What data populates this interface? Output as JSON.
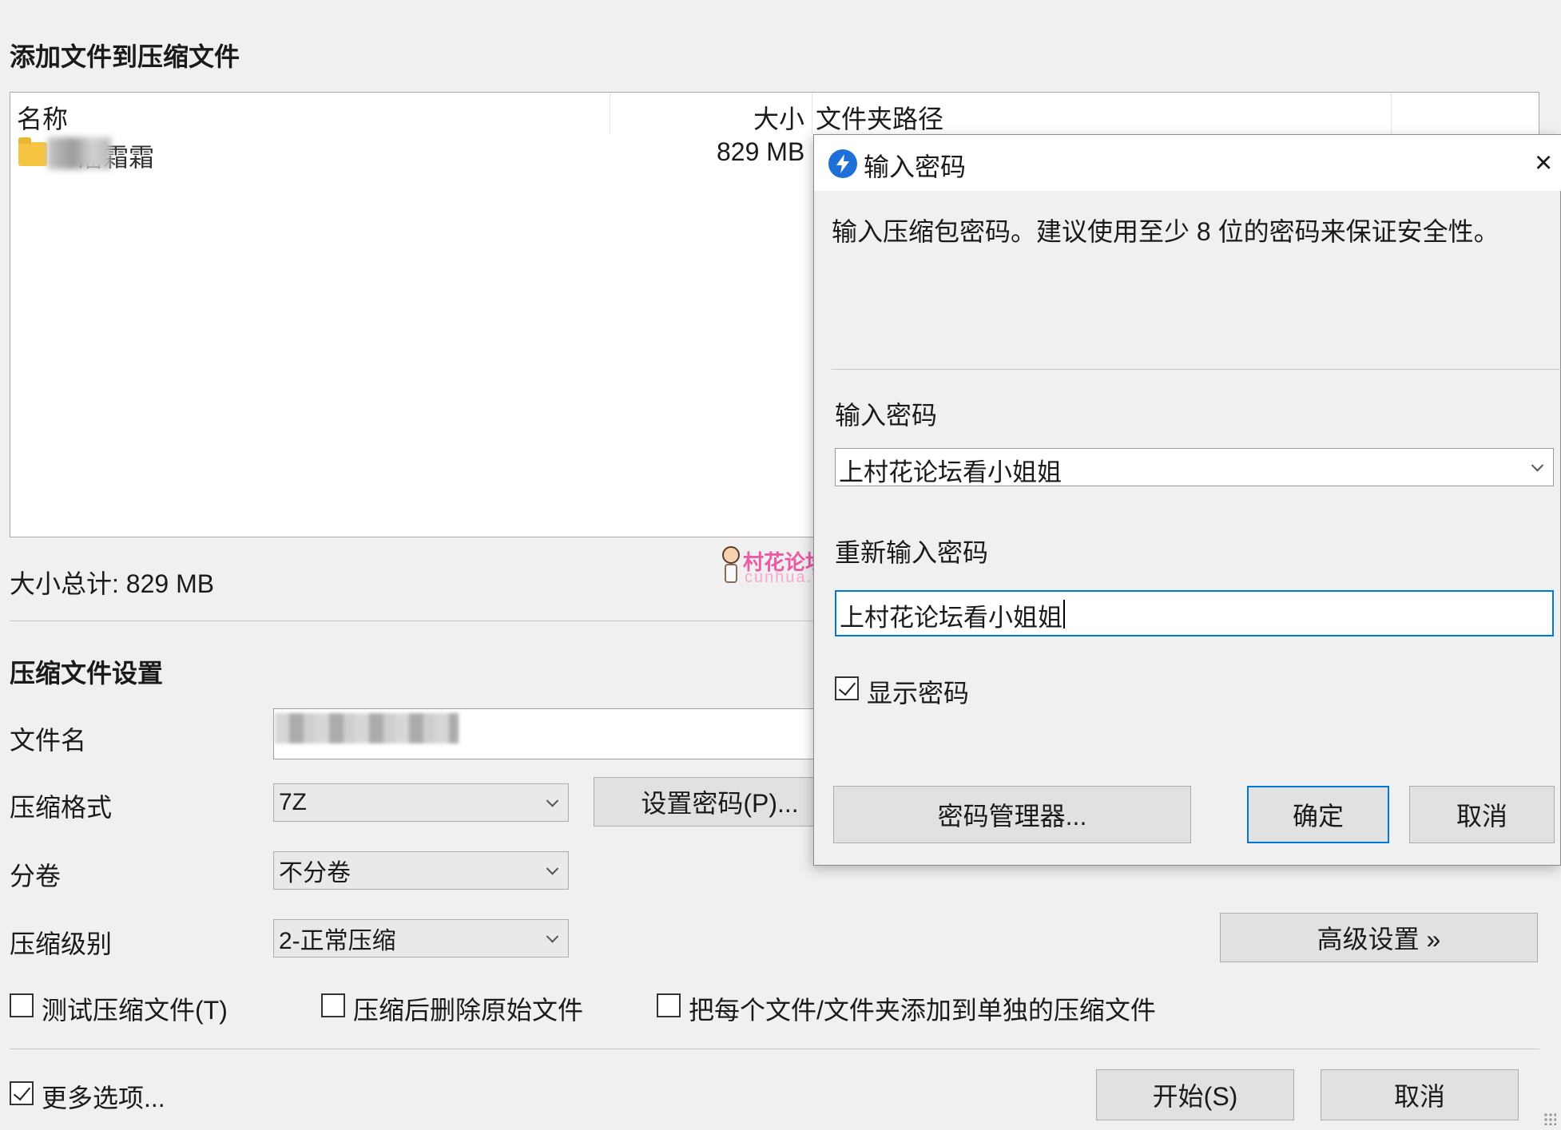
{
  "main": {
    "title": "添加文件到压缩文件",
    "file_list": {
      "columns": [
        "名称",
        "大小",
        "文件夹路径"
      ],
      "rows": [
        {
          "name": "潘霜霜",
          "size": "829 MB"
        }
      ]
    },
    "total_size": "大小总计: 829 MB",
    "settings_title": "压缩文件设置",
    "filename_label": "文件名",
    "format_label": "压缩格式",
    "format_value": "7Z",
    "set_password_button": "设置密码(P)...",
    "split_label": "分卷",
    "split_value": "不分卷",
    "level_label": "压缩级别",
    "level_value": "2-正常压缩",
    "advanced_button": "高级设置 »",
    "options": [
      {
        "label": "测试压缩文件(T)",
        "checked": false
      },
      {
        "label": "压缩后删除原始文件",
        "checked": false
      },
      {
        "label": "把每个文件/文件夹添加到单独的压缩文件",
        "checked": false
      }
    ],
    "more_options": {
      "label": "更多选项...",
      "checked": true
    },
    "start_button": "开始(S)",
    "cancel_button": "取消"
  },
  "dialog": {
    "title": "输入密码",
    "close": "×",
    "description": "输入压缩包密码。建议使用至少 8 位的密码来保证安全性。",
    "password_label": "输入密码",
    "password_value": "上村花论坛看小姐姐",
    "reenter_label": "重新输入密码",
    "reenter_value": "上村花论坛看小姐姐",
    "show_password": {
      "label": "显示密码",
      "checked": true
    },
    "manager_button": "密码管理器...",
    "ok_button": "确定",
    "cancel_button": "取消"
  },
  "watermark": {
    "text": "村花论坛",
    "sub": "cunhua.win"
  },
  "colors": {
    "background": "#f0f0f0",
    "primary_border": "#0078d7",
    "app_icon": "#1f6fd8",
    "watermark": "#ec5aa3"
  }
}
